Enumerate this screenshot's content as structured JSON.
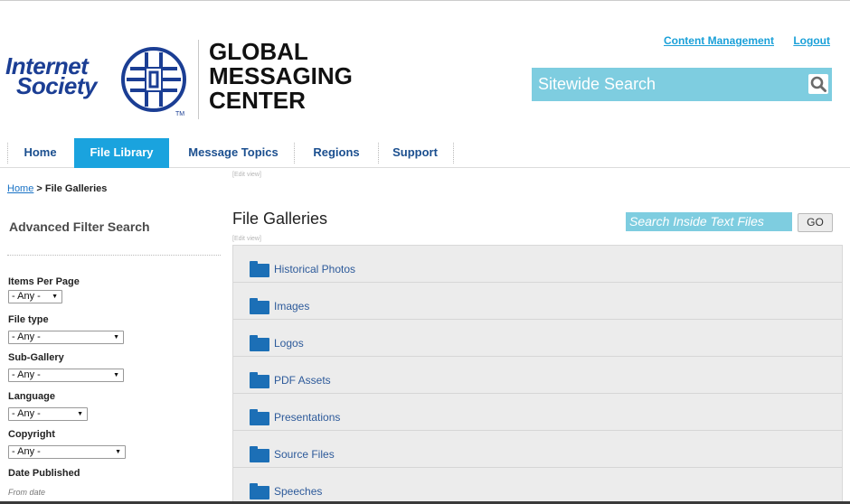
{
  "logo": {
    "line1": "Internet",
    "line2": "Society",
    "tm": "TM",
    "globe_icon": "isoc-globe-icon"
  },
  "site_title": {
    "line1": "GLOBAL",
    "line2": "MESSAGING",
    "line3": "CENTER"
  },
  "top_links": {
    "content_management": "Content Management",
    "logout": "Logout"
  },
  "site_search": {
    "placeholder": "Sitewide Search",
    "icon": "search-icon"
  },
  "nav": {
    "items": [
      {
        "label": "Home"
      },
      {
        "label": "File Library",
        "active": true
      },
      {
        "label": "Message Topics"
      },
      {
        "label": "Regions"
      },
      {
        "label": "Support"
      }
    ]
  },
  "edit_view": "[Edit view]",
  "breadcrumb": {
    "home": "Home",
    "separator": " > ",
    "current": "File Galleries"
  },
  "sidebar": {
    "title": "Advanced Filter Search",
    "filters": [
      {
        "label": "Items Per Page",
        "value": "- Any -"
      },
      {
        "label": "File type",
        "value": "- Any -"
      },
      {
        "label": "Sub-Gallery",
        "value": "- Any -"
      },
      {
        "label": "Language",
        "value": "- Any -"
      },
      {
        "label": "Copyright",
        "value": "- Any -"
      }
    ],
    "date_published": {
      "label": "Date Published",
      "from_label": "From date"
    }
  },
  "main": {
    "title": "File Galleries",
    "text_search": {
      "placeholder": "Search Inside Text Files"
    },
    "go_label": "GO",
    "galleries": [
      {
        "label": "Historical Photos"
      },
      {
        "label": "Images"
      },
      {
        "label": "Logos"
      },
      {
        "label": "PDF Assets"
      },
      {
        "label": "Presentations"
      },
      {
        "label": "Source Files"
      },
      {
        "label": "Speeches"
      }
    ]
  },
  "colors": {
    "accent": "#1aa3de",
    "search_bg": "#7ecde0",
    "link": "#1a73c6",
    "folder": "#1c6fb6",
    "logo_blue": "#1b3e94"
  }
}
